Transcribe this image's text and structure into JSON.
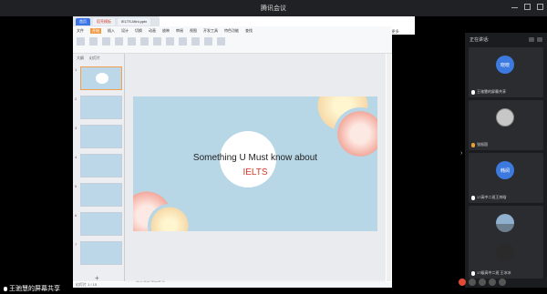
{
  "window": {
    "title": "腾讯会议"
  },
  "sharer": {
    "label": "王驰慧的屏幕共享"
  },
  "ppt": {
    "tabs": [
      "首页",
      "稻壳模板",
      "IELTS-Mini.pptx"
    ],
    "toolbar_top": [
      "静音",
      "开启视频",
      "共享屏幕",
      "管理成员",
      "邀请",
      "更多"
    ],
    "menu": [
      "文件",
      "开始",
      "插入",
      "设计",
      "切换",
      "动画",
      "放映",
      "审阅",
      "视图",
      "开发工具",
      "特色功能",
      "查找"
    ],
    "thumb_head": [
      "大纲",
      "幻灯片"
    ],
    "slide_title": "Something U Must know about",
    "slide_subtitle": "IELTS",
    "note_hint": "单击此处添加备注",
    "status": "幻灯片 1 / 15"
  },
  "panel": {
    "title": "正在讲话:",
    "participants": [
      {
        "avatar_text": "晓晓",
        "name": "王驰慧的屏幕共享",
        "avatar_style": "blue",
        "mic": "white"
      },
      {
        "avatar_text": "",
        "name": "张振国",
        "avatar_style": "photo",
        "mic": "orange"
      },
      {
        "avatar_text": "韩阅",
        "name": "17高中二班王梓晗",
        "avatar_style": "blue",
        "mic": "white"
      },
      {
        "avatar_text": "",
        "name": "昆仑",
        "avatar_style": "sky",
        "mic": "white"
      },
      {
        "avatar_text": "",
        "name": "17级高中二班 王冰冰",
        "avatar_style": "dark",
        "mic": "white"
      }
    ]
  }
}
